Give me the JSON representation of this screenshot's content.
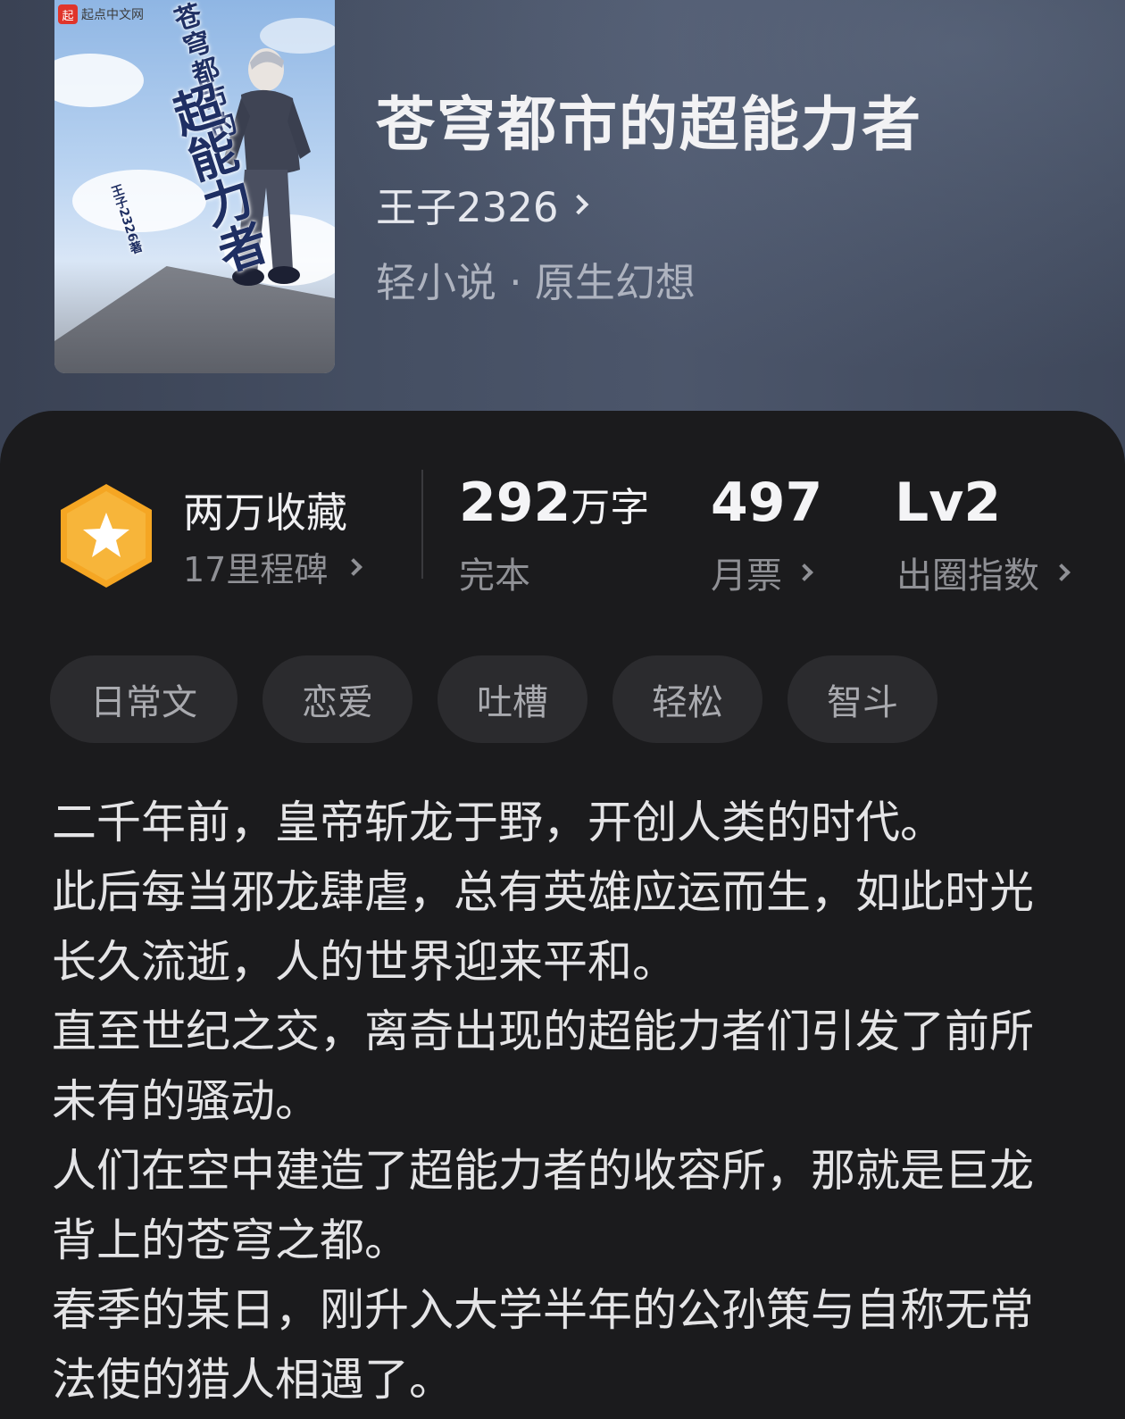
{
  "cover": {
    "logo_text": "起点中文网",
    "logo_mark": "起",
    "title_line1": "苍穹都市的",
    "title_line2": "超能力者",
    "author_mark": "王子2326著"
  },
  "book": {
    "title": "苍穹都市的超能力者",
    "author": "王子2326",
    "category": "轻小说 · 原生幻想"
  },
  "stats": {
    "collect_title": "两万收藏",
    "collect_sub": "17里程碑",
    "words_value": "292",
    "words_unit": "万字",
    "words_label": "完本",
    "tickets_value": "497",
    "tickets_label": "月票",
    "level_value": "Lv2",
    "level_label": "出圈指数"
  },
  "tags": [
    "日常文",
    "恋爱",
    "吐槽",
    "轻松",
    "智斗"
  ],
  "synopsis": [
    "二千年前，皇帝斩龙于野，开创人类的时代。",
    "此后每当邪龙肆虐，总有英雄应运而生，如此时光长久流逝，人的世界迎来平和。",
    "直至世纪之交，离奇出现的超能力者们引发了前所未有的骚动。",
    "人们在空中建造了超能力者的收容所，那就是巨龙背上的苍穹之都。",
    "春季的某日，刚升入大学半年的公孙策与自称无常法使的猎人相遇了。"
  ],
  "colors": {
    "medal_orange": "#f5a623",
    "panel_bg": "#1b1b1d",
    "tag_bg": "#2b2b2e"
  }
}
